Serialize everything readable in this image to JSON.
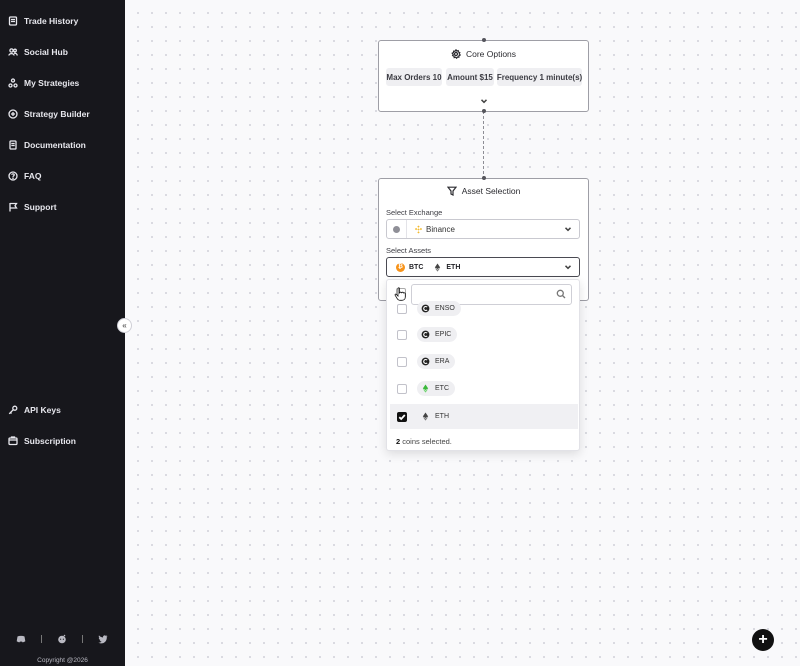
{
  "sidebar": {
    "items": [
      {
        "label": "Trade History",
        "icon": "receipt-icon"
      },
      {
        "label": "Social Hub",
        "icon": "users-icon"
      },
      {
        "label": "My Strategies",
        "icon": "strategies-icon"
      },
      {
        "label": "Strategy Builder",
        "icon": "plus-circle-icon"
      },
      {
        "label": "Documentation",
        "icon": "document-icon"
      },
      {
        "label": "FAQ",
        "icon": "question-icon"
      },
      {
        "label": "Support",
        "icon": "flag-icon"
      }
    ],
    "bottom_items": [
      {
        "label": "API Keys",
        "icon": "key-icon"
      },
      {
        "label": "Subscription",
        "icon": "card-icon"
      }
    ],
    "social": [
      "discord-icon",
      "reddit-icon",
      "twitter-icon"
    ],
    "copyright": "Copyright @2026",
    "collapse_glyph": "«"
  },
  "core_node": {
    "title": "Core Options",
    "chips": [
      "Max Orders 10",
      "Amount $15",
      "Frequency 1 minute(s)"
    ]
  },
  "asset_node": {
    "title": "Asset Selection",
    "exchange_label": "Select Exchange",
    "exchange_value": "Binance",
    "assets_label": "Select Assets",
    "selected_assets": [
      "BTC",
      "ETH"
    ]
  },
  "dropdown": {
    "search_placeholder": "",
    "options": [
      {
        "symbol": "ENSO",
        "checked": false
      },
      {
        "symbol": "EPIC",
        "checked": false
      },
      {
        "symbol": "ERA",
        "checked": false
      },
      {
        "symbol": "ETC",
        "checked": false
      },
      {
        "symbol": "ETH",
        "checked": true
      }
    ],
    "selected_count": "2",
    "footer_suffix": "coins selected."
  },
  "colors": {
    "sidebar_bg": "#17171c",
    "btc": "#f7931a",
    "binance": "#f3ba2f",
    "etc": "#3ab83a"
  },
  "add_button_label": "+"
}
